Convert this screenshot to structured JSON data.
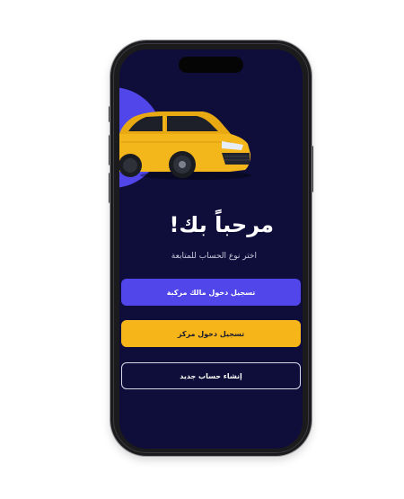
{
  "screen": {
    "welcome_title": "مرحباً بك!",
    "subtitle": "اختر نوع الحساب للمتابعة"
  },
  "actions": {
    "owner_login_label": "تسجيل دخول مالك مركبة",
    "center_login_label": "تسجيل دخول مركز",
    "create_account_label": "إنشاء حساب جديد"
  },
  "colors": {
    "screen_background": "#0f0e3b",
    "accent_purple": "#5146ea",
    "accent_yellow": "#f6b619",
    "car_body": "#f4b71b",
    "text_primary": "#ffffff"
  },
  "icons": [
    "car-illustration"
  ]
}
